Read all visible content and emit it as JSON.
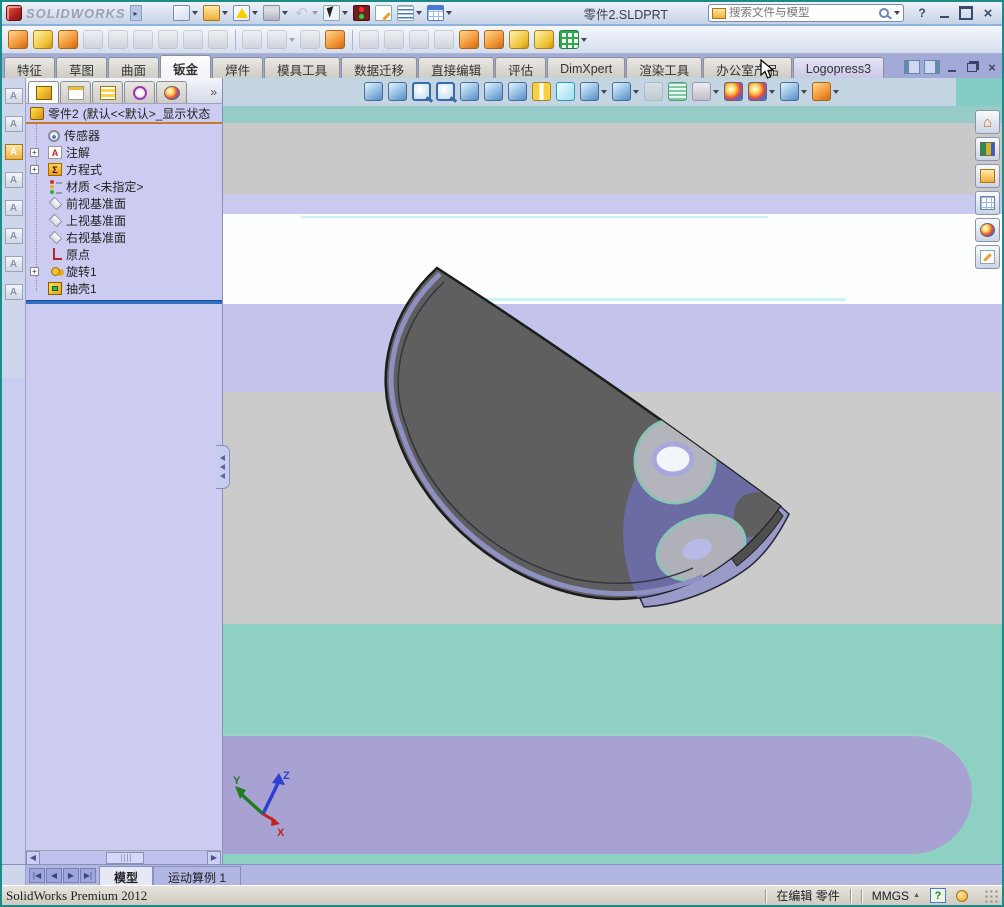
{
  "brand": {
    "logo_text": "SOLIDWORKS"
  },
  "titlebar": {
    "document_title": "零件2.SLDPRT",
    "search": {
      "placeholder": "搜索文件与模型"
    },
    "tools": [
      {
        "icon": "new-document-icon",
        "dropdown": true
      },
      {
        "icon": "open-folder-icon",
        "dropdown": true
      },
      {
        "icon": "save-icon",
        "dropdown": true
      },
      {
        "icon": "print-icon",
        "dropdown": true
      },
      {
        "icon": "undo-icon",
        "dropdown": true,
        "disabled": true
      },
      {
        "icon": "select-cursor-icon",
        "dropdown": true
      },
      {
        "icon": "rebuild-traffic-light-icon"
      },
      {
        "icon": "file-properties-icon"
      },
      {
        "icon": "options-list-icon",
        "dropdown": true
      },
      {
        "icon": "design-table-icon",
        "dropdown": true
      }
    ],
    "window_controls": [
      {
        "icon": "help-icon",
        "glyph": "?"
      },
      {
        "icon": "minimize-icon",
        "glyph": ""
      },
      {
        "icon": "maximize-icon",
        "glyph": ""
      },
      {
        "icon": "close-icon",
        "glyph": "×"
      }
    ]
  },
  "sheetmetal_toolbar": {
    "items": [
      {
        "icon": "base-flange-icon",
        "tone": "orange"
      },
      {
        "icon": "convert-to-sheetmetal-icon",
        "tone": "yellowcube"
      },
      {
        "icon": "lofted-bend-icon",
        "tone": "orange"
      },
      {
        "icon": "edge-flange-icon",
        "tone": "gray",
        "disabled": true
      },
      {
        "icon": "miter-flange-icon",
        "tone": "gray",
        "disabled": true
      },
      {
        "icon": "hem-icon",
        "tone": "gray",
        "disabled": true
      },
      {
        "icon": "jog-icon",
        "tone": "gray",
        "disabled": true
      },
      {
        "icon": "sketched-bend-icon",
        "tone": "gray",
        "disabled": true
      },
      {
        "icon": "cross-break-icon",
        "tone": "gray",
        "disabled": true
      },
      {
        "icon": "toolbar-separator",
        "sep": true
      },
      {
        "icon": "closed-corner-icon",
        "tone": "gray",
        "disabled": true
      },
      {
        "icon": "corner-relief-icon",
        "tone": "gray",
        "disabled": true,
        "dropdown": true
      },
      {
        "icon": "break-corner-icon",
        "tone": "gray",
        "disabled": true
      },
      {
        "icon": "forming-tool-icon",
        "tone": "orange"
      },
      {
        "icon": "toolbar-separator",
        "sep": true
      },
      {
        "icon": "extruded-cut-icon",
        "tone": "gray",
        "disabled": true
      },
      {
        "icon": "simple-hole-icon",
        "tone": "gray",
        "disabled": true
      },
      {
        "icon": "vent-icon",
        "tone": "gray",
        "disabled": true
      },
      {
        "icon": "no-bends-icon",
        "tone": "gray",
        "disabled": true
      },
      {
        "icon": "unfold-icon",
        "tone": "orange"
      },
      {
        "icon": "fold-icon",
        "tone": "orange"
      },
      {
        "icon": "flatten-icon",
        "tone": "yellowcube"
      },
      {
        "icon": "insert-bends-icon",
        "tone": "yellowcube"
      },
      {
        "icon": "rip-icon",
        "tone": "greengrid",
        "dropdown": true
      }
    ]
  },
  "command_tabs": {
    "tabs": [
      {
        "label": "特征"
      },
      {
        "label": "草图"
      },
      {
        "label": "曲面"
      },
      {
        "label": "钣金",
        "active": true
      },
      {
        "label": "焊件"
      },
      {
        "label": "模具工具"
      },
      {
        "label": "数据迁移"
      },
      {
        "label": "直接编辑"
      },
      {
        "label": "评估"
      },
      {
        "label": "DimXpert"
      },
      {
        "label": "渲染工具"
      },
      {
        "label": "办公室产品"
      },
      {
        "label": "Logopress3",
        "hovered": true
      }
    ],
    "window_buttons": [
      {
        "icon": "collapse-pane-icon"
      },
      {
        "icon": "expand-pane-icon"
      },
      {
        "icon": "minimize-icon"
      },
      {
        "icon": "restore-icon"
      },
      {
        "icon": "close-icon",
        "glyph": "×"
      }
    ]
  },
  "left_toolbar": {
    "items": [
      {
        "icon": "note-tool-icon"
      },
      {
        "icon": "spellcheck-tool-icon"
      },
      {
        "icon": "open-annotations-folder-icon"
      },
      {
        "icon": "design-checker-icon"
      },
      {
        "icon": "annotation-view-icon"
      },
      {
        "icon": "lock-note-icon"
      },
      {
        "icon": "image-note-icon"
      },
      {
        "icon": "hyperlink-tool-icon"
      }
    ]
  },
  "feature_tree": {
    "panel_tabs": [
      {
        "icon": "featuremanager-tab-icon",
        "active": true
      },
      {
        "icon": "propertymanager-tab-icon"
      },
      {
        "icon": "configurationmanager-tab-icon"
      },
      {
        "icon": "dimxpertmanager-tab-icon"
      },
      {
        "icon": "displaymanager-tab-icon"
      }
    ],
    "overflow_glyph": "»",
    "root": {
      "label": "零件2",
      "config": "(默认<<默认>_显示状态",
      "icon": "part-root-icon"
    },
    "items": [
      {
        "label": "传感器",
        "icon": "sensor-icon"
      },
      {
        "label": "注解",
        "icon": "annotation-icon",
        "expandable": true
      },
      {
        "label": "方程式",
        "icon": "equation-icon",
        "expandable": true
      },
      {
        "label": "材质 <未指定>",
        "icon": "material-icon"
      },
      {
        "label": "前视基准面",
        "icon": "plane-icon"
      },
      {
        "label": "上视基准面",
        "icon": "plane-icon"
      },
      {
        "label": "右视基准面",
        "icon": "plane-icon"
      },
      {
        "label": "原点",
        "icon": "origin-icon"
      },
      {
        "label": "旋转1",
        "icon": "revolve-icon",
        "expandable": true
      },
      {
        "label": "抽壳1",
        "icon": "shell-icon"
      }
    ]
  },
  "hud_toolbar": {
    "items": [
      {
        "icon": "pane-vertical-icon",
        "tone": "blue"
      },
      {
        "icon": "pane-horizontal-icon",
        "tone": "blue"
      },
      {
        "icon": "zoom-fit-icon",
        "tone": "mag"
      },
      {
        "icon": "zoom-area-icon",
        "tone": "mag"
      },
      {
        "icon": "previous-view-icon",
        "tone": "blue"
      },
      {
        "icon": "view-telescope-icon",
        "tone": "blue"
      },
      {
        "icon": "view-return-icon",
        "tone": "blue"
      },
      {
        "icon": "section-view-icon",
        "tone": "yellow"
      },
      {
        "icon": "view-orientation-icon",
        "tone": "cyan"
      },
      {
        "icon": "display-style-icon",
        "tone": "blue",
        "dropdown": true
      },
      {
        "icon": "display-mode-icon",
        "tone": "blue",
        "dropdown": true
      },
      {
        "icon": "hide-show-items-icon",
        "tone": "gray",
        "disabled": true
      },
      {
        "icon": "appearance-stripes-icon",
        "tone": "green"
      },
      {
        "icon": "view-settings-icon",
        "tone": "gray",
        "dropdown": true
      },
      {
        "icon": "appearances-ball-icon",
        "tone": "rainbow"
      },
      {
        "icon": "render-options-icon",
        "tone": "rainbow",
        "dropdown": true
      },
      {
        "icon": "scene-icon",
        "tone": "blue",
        "dropdown": true
      },
      {
        "icon": "instant3d-icon",
        "tone": "orange",
        "dropdown": true
      }
    ]
  },
  "task_pane": {
    "items": [
      {
        "icon": "home-resources-icon"
      },
      {
        "icon": "design-library-icon"
      },
      {
        "icon": "file-explorer-icon"
      },
      {
        "icon": "view-palette-icon"
      },
      {
        "icon": "appearances-icon"
      },
      {
        "icon": "custom-properties-icon"
      }
    ]
  },
  "viewport": {
    "triad": {
      "x_label": "X",
      "y_label": "Y",
      "z_label": "Z"
    },
    "colors": {
      "model_gray": "#5f5f5f",
      "model_rim": "#8f8fc2",
      "reflection_patch": "#6c6ca4",
      "highlight_ring": "#8cc4b4",
      "band_teal": "#96cbc8",
      "band_gray": "#c9c9c9",
      "band_lavender": "#c3c3ec",
      "band_white": "#fdfeff",
      "band_teal_low": "#8ed0c2",
      "band_purple": "#a8a2d3"
    }
  },
  "bottom_bar": {
    "nav": [
      {
        "icon": "scroll-first-icon",
        "glyph": "|◀"
      },
      {
        "icon": "scroll-prev-icon",
        "glyph": "◀"
      },
      {
        "icon": "scroll-next-icon",
        "glyph": "▶"
      },
      {
        "icon": "scroll-last-icon",
        "glyph": "▶|"
      }
    ],
    "tabs": [
      {
        "label": "模型",
        "active": true
      },
      {
        "label": "运动算例 1"
      }
    ]
  },
  "status_bar": {
    "product": "SolidWorks Premium 2012",
    "editing": "在编辑 零件",
    "units": "MMGS",
    "help_glyph": "?"
  }
}
